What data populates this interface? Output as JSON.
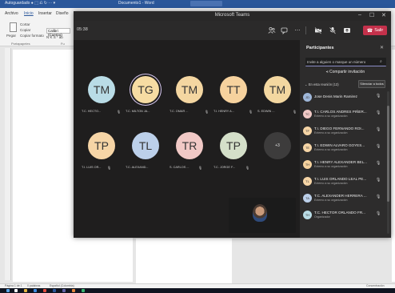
{
  "word": {
    "title_left": "Autoguardado ● ⬚ ⎌ ↻ ⋯ ▾",
    "title_doc": "Documento1 - Word",
    "tabs": [
      "Archivo",
      "Inicio",
      "Insertar",
      "Diseño"
    ],
    "ribbon": {
      "paste": "Pegar",
      "cut": "Cortar",
      "copy": "Copiar",
      "format_painter": "Copiar formato",
      "font_name": "Calibri (Cuerpo)",
      "font_row2": "N  K  S  ·  ab",
      "clipboard_group": "Portapapeles",
      "font_group": "Fu"
    },
    "status": {
      "page": "Página 1 de 1",
      "words": "0 palabras",
      "lang": "Español (Colombia)",
      "focus": "Concentración"
    }
  },
  "teams": {
    "window_title": "Microsoft Teams",
    "controls": {
      "minimize": "–",
      "maximize": "☐",
      "close": "✕"
    },
    "timer": "05:38",
    "leave_label": "Salir",
    "tiles": [
      {
        "initials": "TM",
        "name": "T.C. HECTO...",
        "color": "#b9dce6",
        "speaking": false
      },
      {
        "initials": "TG",
        "name": "T.C. MILTON JA...",
        "color": "#f6dca3",
        "speaking": true
      },
      {
        "initials": "TM",
        "name": "T.C. OMAR ...",
        "color": "#f4d6a1",
        "speaking": false
      },
      {
        "initials": "TT",
        "name": "T.I. HENRY A...",
        "color": "#f6d29e",
        "speaking": false
      },
      {
        "initials": "TM",
        "name": "S. EDWIN ...",
        "color": "#f3d7a0",
        "speaking": false
      },
      {
        "initials": "TP",
        "name": "T.I. LUIS OR...",
        "color": "#f6d5a6",
        "speaking": false
      },
      {
        "initials": "TL",
        "name": "T.C. ALEXAND...",
        "color": "#bcd0ea",
        "speaking": false
      },
      {
        "initials": "TR",
        "name": "S. CARLOS ...",
        "color": "#f1c9c6",
        "speaking": false
      },
      {
        "initials": "TP",
        "name": "T.C. JORGE F...",
        "color": "#d4dfc9",
        "speaking": false
      }
    ],
    "more_count": "+3",
    "panel": {
      "title": "Participantes",
      "invite_placeholder": "Invite a alguien o marque un número",
      "share_label": "Compartir invitación",
      "in_meeting_label": "En esta reunión (13)",
      "mute_all_label": "Silenciar a todos",
      "participants": [
        {
          "initials": "JD",
          "name": "Jose Denis Marin Ramirez",
          "sub": "",
          "color": "#9fb7d9"
        },
        {
          "initials": "TC",
          "name": "T.I. CARLOS ANDRES PIÑER...",
          "sub": "Externo a su organización",
          "color": "#f1c9c6"
        },
        {
          "initials": "TF",
          "name": "T.I. DIEGO FERNANDO ROI...",
          "sub": "Externo a su organización",
          "color": "#f6d5a6"
        },
        {
          "initials": "TE",
          "name": "T.I. EDWIN ALVARO GOYES...",
          "sub": "Externo a su organización",
          "color": "#f6d5a6"
        },
        {
          "initials": "TH",
          "name": "T.I. HENRY ALEXANDER BEL...",
          "sub": "Externo a su organización",
          "color": "#f6d29e"
        },
        {
          "initials": "TL",
          "name": "T.I. LUIS ORLANDO LEAL PE...",
          "sub": "Externo a su organización",
          "color": "#f6d5a6"
        },
        {
          "initials": "TA",
          "name": "T.C. ALEXANDER HERRERA ...",
          "sub": "Externo a su organización",
          "color": "#bcd0ea"
        },
        {
          "initials": "TH",
          "name": "T.C. HECTOR ORLANDO FR...",
          "sub": "Organizador",
          "color": "#b9dce6"
        }
      ]
    }
  }
}
